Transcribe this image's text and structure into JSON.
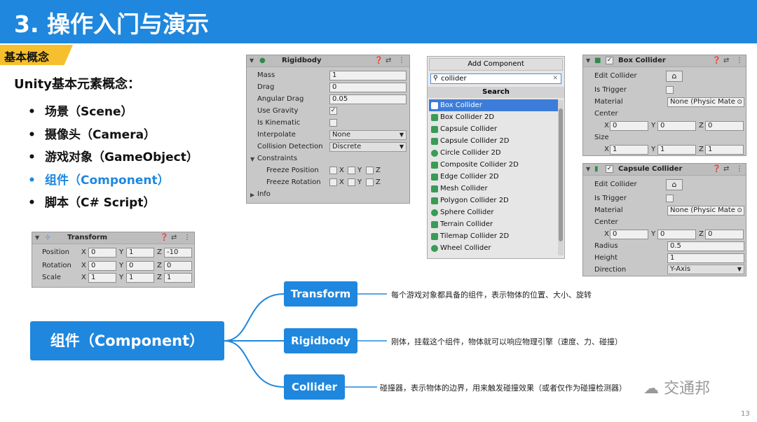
{
  "header": {
    "title": "3. 操作入门与演示"
  },
  "tag": "基本概念",
  "heading": "Unity基本元素概念：",
  "bullets": [
    {
      "bullet": "•",
      "text": "场景（Scene）"
    },
    {
      "bullet": "•",
      "text": "摄像头（Camera）"
    },
    {
      "bullet": "•",
      "text": "游戏对象（GameObject）"
    },
    {
      "bullet": "•",
      "text": "组件（Component）"
    },
    {
      "bullet": "•",
      "text": "脚本（C# Script）"
    }
  ],
  "transform": {
    "title": "Transform",
    "rows": [
      {
        "label": "Position",
        "x": "0",
        "y": "1",
        "z": "-10"
      },
      {
        "label": "Rotation",
        "x": "0",
        "y": "0",
        "z": "0"
      },
      {
        "label": "Scale",
        "x": "1",
        "y": "1",
        "z": "1"
      }
    ]
  },
  "axes": {
    "x": "X",
    "y": "Y",
    "z": "Z"
  },
  "rigidbody": {
    "title": "Rigidbody",
    "mass_label": "Mass",
    "mass": "1",
    "drag_label": "Drag",
    "drag": "0",
    "angular_label": "Angular Drag",
    "angular": "0.05",
    "gravity_label": "Use Gravity",
    "gravity_check": "✓",
    "kinematic_label": "Is Kinematic",
    "interp_label": "Interpolate",
    "interp": "None",
    "collision_label": "Collision Detection",
    "collision": "Discrete",
    "constraints_label": "Constraints",
    "freeze_pos": "Freeze Position",
    "freeze_rot": "Freeze Rotation",
    "info_label": "Info"
  },
  "add_component": {
    "title": "Add Component",
    "search_value": "collider",
    "search_header": "Search",
    "items": [
      "Box Collider",
      "Box Collider 2D",
      "Capsule Collider",
      "Capsule Collider 2D",
      "Circle Collider 2D",
      "Composite Collider 2D",
      "Edge Collider 2D",
      "Mesh Collider",
      "Polygon Collider 2D",
      "Sphere Collider",
      "Terrain Collider",
      "Tilemap Collider 2D",
      "Wheel Collider"
    ]
  },
  "box_collider": {
    "title": "Box Collider",
    "check": "✓",
    "edit_label": "Edit Collider",
    "trigger_label": "Is Trigger",
    "material_label": "Material",
    "material": "None (Physic Mate",
    "center_label": "Center",
    "cx": "0",
    "cy": "0",
    "cz": "0",
    "size_label": "Size",
    "sx": "1",
    "sy": "1",
    "sz": "1"
  },
  "capsule_collider": {
    "title": "Capsule Collider",
    "check": "✓",
    "edit_label": "Edit Collider",
    "trigger_label": "Is Trigger",
    "material_label": "Material",
    "material": "None (Physic Mate",
    "center_label": "Center",
    "cx": "0",
    "cy": "0",
    "cz": "0",
    "radius_label": "Radius",
    "radius": "0.5",
    "height_label": "Height",
    "height": "1",
    "direction_label": "Direction",
    "direction": "Y-Axis"
  },
  "mindmap": {
    "root": "组件（Component）",
    "nodes": [
      {
        "label": "Transform",
        "desc": "每个游戏对象都具备的组件，表示物体的位置、大小、旋转"
      },
      {
        "label": "Rigidbody",
        "desc": "刚体，挂载这个组件，物体就可以响应物理引擎（速度、力、碰撞）"
      },
      {
        "label": "Collider",
        "desc": "碰撞器，表示物体的边界，用来触发碰撞效果（或者仅作为碰撞检测器）"
      }
    ]
  },
  "watermark": "交通邦",
  "page_number": "13",
  "colors": {
    "accent": "#1f87de",
    "tag": "#f5bf2e",
    "selection": "#3d7dd9"
  }
}
